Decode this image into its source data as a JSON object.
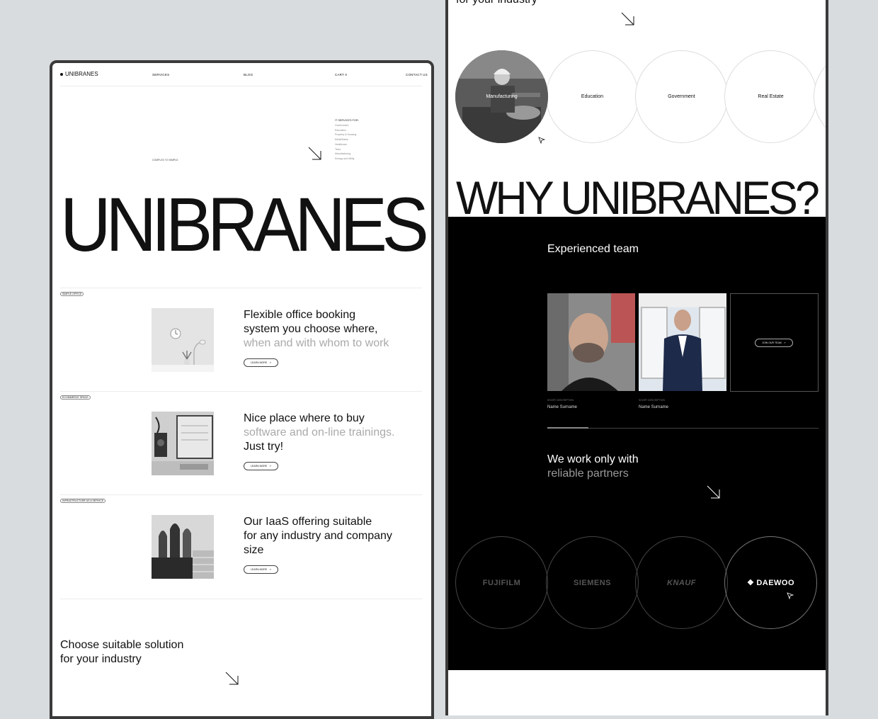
{
  "left": {
    "logo": "UNIBRANES",
    "nav": [
      "SERVICES",
      "BLOG",
      "CART 0",
      "CONTACT US"
    ],
    "tagline": "COMPLEX TO SIMPLE",
    "it_services": {
      "title": "IT SERVICES FOR:",
      "items": [
        "Government",
        "Education",
        "Property & Housing",
        "Retail/Sales",
        "Healthcare",
        "Telco",
        "Manufacturing",
        "Energy and Utility"
      ]
    },
    "hero": "UNIBRANES",
    "sections": [
      {
        "tag": "SIMPLE OFFICE",
        "line1": "Flexible office booking",
        "line2": "system you choose where,",
        "line3": "when and with whom to work",
        "button": "LEARN MORE"
      },
      {
        "tag": "ECOMMERCE SPACE",
        "line1": "Nice place where to buy",
        "line2": "software and on-line trainings.",
        "line3": "Just try!",
        "button": "LEARN MORE"
      },
      {
        "tag": "INFRASTRUCTURE AS A SERVICE",
        "line1": "Our IaaS offering suitable",
        "line2": "for any industry and company",
        "line3": "size",
        "button": "LEARN MORE"
      }
    ],
    "choose": {
      "line1": "Choose suitable solution",
      "line2": "for your industry"
    }
  },
  "right": {
    "top_text": "for your industry",
    "industries": [
      "Manufacturing",
      "Education",
      "Government",
      "Real Estate"
    ],
    "why": "WHY UNIBRANES?",
    "team_title": "Experienced team",
    "team": [
      {
        "caption": "SHORT DESCRIPTION",
        "name": "Name Surname"
      },
      {
        "caption": "SHORT DESCRIPTION",
        "name": "Name Surname"
      }
    ],
    "join_button": "JOIN OUR TEAM",
    "partners_line1": "We work only with",
    "partners_line2": "reliable partners",
    "partners": [
      "FUJIFILM",
      "SIEMENS",
      "KNAUF",
      "DAEWOO"
    ]
  },
  "colors": {
    "accent": "#000000",
    "muted": "#aaaaaa",
    "background": "#d9dcde"
  }
}
